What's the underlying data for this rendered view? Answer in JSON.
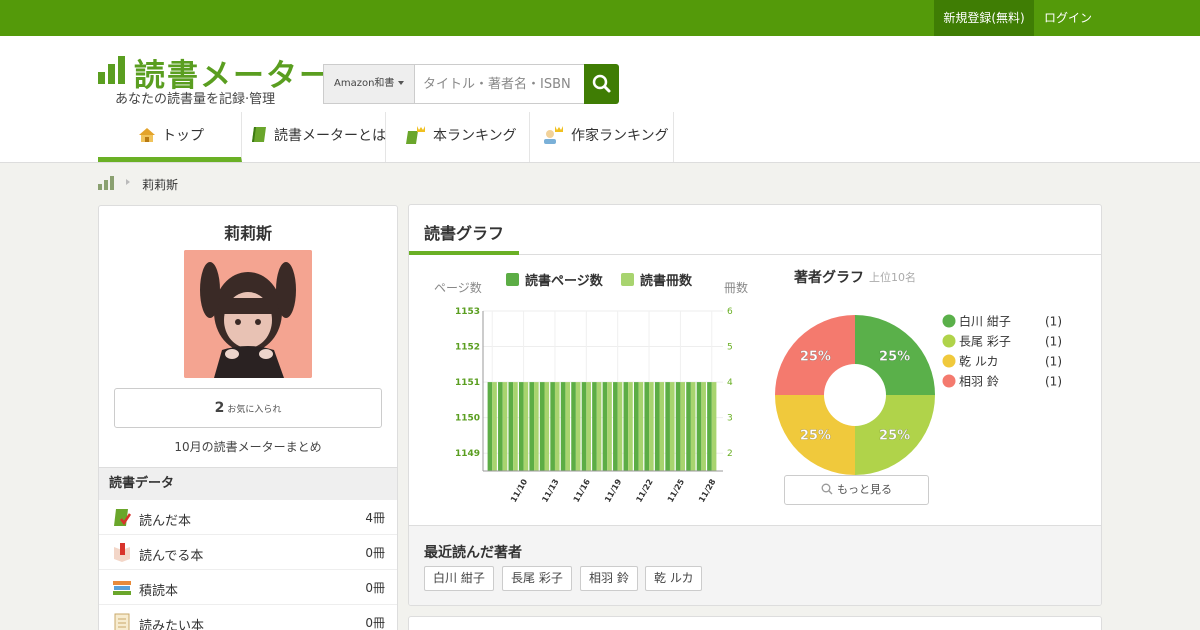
{
  "topbar": {
    "register": "新規登録(無料)",
    "login": "ログイン"
  },
  "logo": {
    "title": "読書メーター",
    "tagline": "あなたの読書量を記録·管理"
  },
  "search": {
    "category": "Amazon和書",
    "placeholder": "タイトル・著者名・ISBN"
  },
  "nav": [
    {
      "label": "トップ",
      "icon": "house-icon",
      "active": true
    },
    {
      "label": "読書メーターとは",
      "icon": "book-icon"
    },
    {
      "label": "本ランキング",
      "icon": "book-crown-icon"
    },
    {
      "label": "作家ランキング",
      "icon": "author-crown-icon"
    }
  ],
  "breadcrumb": {
    "current": "莉莉斯"
  },
  "profile": {
    "name": "莉莉斯",
    "favorites_count": "2",
    "favorites_label": "お気に入られ",
    "summary_link": "10月の読書メーターまとめ"
  },
  "reading_data": {
    "title": "読書データ",
    "rows": [
      {
        "label": "読んだ本",
        "count": "4冊",
        "icon": "read-book-icon"
      },
      {
        "label": "読んでる本",
        "count": "0冊",
        "icon": "reading-book-icon"
      },
      {
        "label": "積読本",
        "count": "0冊",
        "icon": "stacked-books-icon"
      },
      {
        "label": "読みたい本",
        "count": "0冊",
        "icon": "wishlist-icon"
      }
    ]
  },
  "graph": {
    "title": "読書グラフ",
    "left_axis_label": "ページ数",
    "right_axis_label": "冊数",
    "legend_pages": "読書ページ数",
    "legend_books": "読書冊数",
    "colors": {
      "pages": "#5cad45",
      "books": "#a8d46f"
    }
  },
  "author_graph": {
    "title": "著者グラフ",
    "subtitle": "上位10名",
    "more_button": "もっと見る"
  },
  "recent_authors": {
    "title": "最近読んだ著者",
    "tags": [
      "白川 紺子",
      "長尾 彩子",
      "相羽 鈴",
      "乾 ルカ"
    ]
  },
  "chart_data": [
    {
      "type": "bar",
      "title": "読書グラフ",
      "ylabel": "ページ数",
      "y2label": "冊数",
      "ylim": [
        1148.5,
        1153
      ],
      "y2lim": [
        1.5,
        6
      ],
      "yticks": [
        1149,
        1150,
        1151,
        1152,
        1153
      ],
      "y2ticks": [
        2,
        3,
        4,
        5,
        6
      ],
      "xticks": [
        "11/10",
        "11/13",
        "11/16",
        "11/19",
        "11/22",
        "11/25",
        "11/28"
      ],
      "x": [
        "11/7",
        "11/8",
        "11/9",
        "11/10",
        "11/11",
        "11/12",
        "11/13",
        "11/14",
        "11/15",
        "11/16",
        "11/17",
        "11/18",
        "11/19",
        "11/20",
        "11/21",
        "11/22",
        "11/23",
        "11/24",
        "11/25",
        "11/26",
        "11/27",
        "11/28"
      ],
      "series": [
        {
          "name": "読書ページ数",
          "axis": "left",
          "values": [
            1151,
            1151,
            1151,
            1151,
            1151,
            1151,
            1151,
            1151,
            1151,
            1151,
            1151,
            1151,
            1151,
            1151,
            1151,
            1151,
            1151,
            1151,
            1151,
            1151,
            1151,
            1151
          ]
        },
        {
          "name": "読書冊数",
          "axis": "right",
          "values": [
            4,
            4,
            4,
            4,
            4,
            4,
            4,
            4,
            4,
            4,
            4,
            4,
            4,
            4,
            4,
            4,
            4,
            4,
            4,
            4,
            4,
            4
          ]
        }
      ]
    },
    {
      "type": "pie",
      "title": "著者グラフ",
      "subtitle": "上位10名",
      "slices": [
        {
          "label": "白川 紺子",
          "count": "(1)",
          "value": 25,
          "color": "#5ab04a"
        },
        {
          "label": "長尾 彩子",
          "count": "(1)",
          "value": 25,
          "color": "#b0d34a"
        },
        {
          "label": "乾 ルカ",
          "count": "(1)",
          "value": 25,
          "color": "#f0c93c"
        },
        {
          "label": "相羽 鈴",
          "count": "(1)",
          "value": 25,
          "color": "#f47a6e"
        }
      ]
    }
  ]
}
